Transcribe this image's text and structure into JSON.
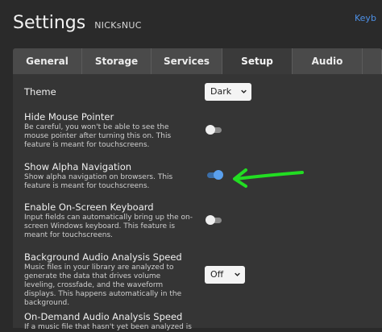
{
  "header": {
    "title": "Settings",
    "server_name": "NICKsNUC",
    "top_right_link": "Keyb"
  },
  "tabs": [
    {
      "label": "General",
      "active": false
    },
    {
      "label": "Storage",
      "active": false
    },
    {
      "label": "Services",
      "active": false
    },
    {
      "label": "Setup",
      "active": true
    },
    {
      "label": "Audio",
      "active": false
    }
  ],
  "settings": {
    "theme": {
      "label": "Theme",
      "value": "Dark"
    },
    "hide_mouse_pointer": {
      "label": "Hide Mouse Pointer",
      "description": "Be careful, you won't be able to see the mouse pointer after turning this on. This feature is meant for touchscreens.",
      "enabled": false
    },
    "show_alpha_navigation": {
      "label": "Show Alpha Navigation",
      "description": "Show alpha navigation on browsers. This feature is meant for touchscreens.",
      "enabled": true
    },
    "on_screen_keyboard": {
      "label": "Enable On-Screen Keyboard",
      "description": "Input fields can automatically bring up the on-screen Windows keyboard. This feature is meant for touchscreens.",
      "enabled": false
    },
    "background_audio_analysis": {
      "label": "Background Audio Analysis Speed",
      "description": "Music files in your library are analyzed to generate the data that drives volume leveling, crossfade, and the waveform displays. This happens automatically in the background.",
      "value": "Off"
    },
    "on_demand_audio_analysis": {
      "label": "On-Demand Audio Analysis Speed",
      "description": "If a music file that hasn't yet been analyzed is"
    }
  },
  "colors": {
    "background": "#2a2a2a",
    "panel": "#353535",
    "tab_bar": "#4a4a4a",
    "toggle_on": "#5aa0ee",
    "annotation_arrow": "#22dd22",
    "link": "#4d90e6"
  },
  "icons": {
    "select_chevron": "chevron-down-icon",
    "annotation": "green-arrow-icon"
  }
}
